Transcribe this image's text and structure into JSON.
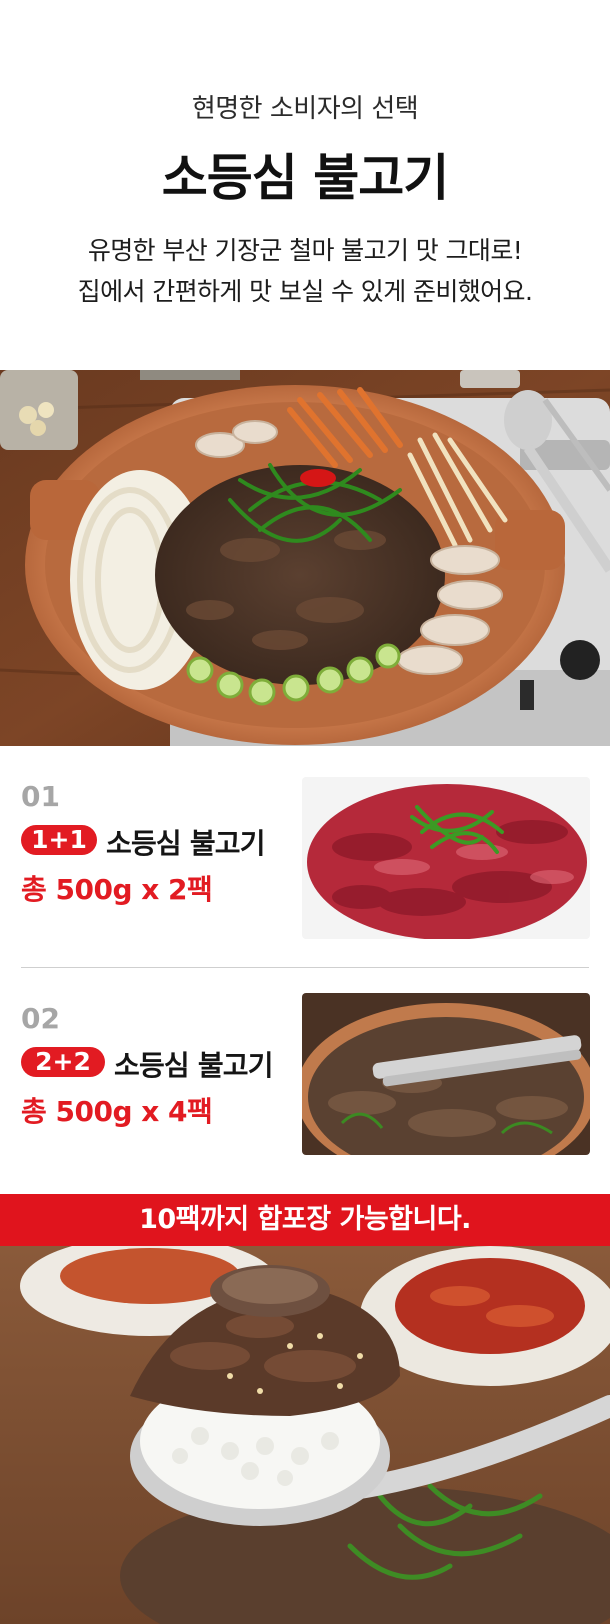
{
  "header": {
    "subtitle": "현명한 소비자의 선택",
    "title": "소등심 불고기",
    "desc_line1": "유명한 부산 기장군 철마 불고기  맛 그대로!",
    "desc_line2": "집에서 간편하게 맛 보실 수 있게 준비했어요."
  },
  "options": [
    {
      "number": "01",
      "badge": "1+1",
      "name": "소등심 불고기",
      "price": "총 500g x 2팩"
    },
    {
      "number": "02",
      "badge": "2+2",
      "name": "소등심 불고기",
      "price": "총 500g x 4팩"
    }
  ],
  "banner": {
    "text": "10팩까지 합포장 가능합니다."
  },
  "colors": {
    "accent": "#e21b22",
    "banner": "#e0141d",
    "number": "#a6a6a6"
  }
}
